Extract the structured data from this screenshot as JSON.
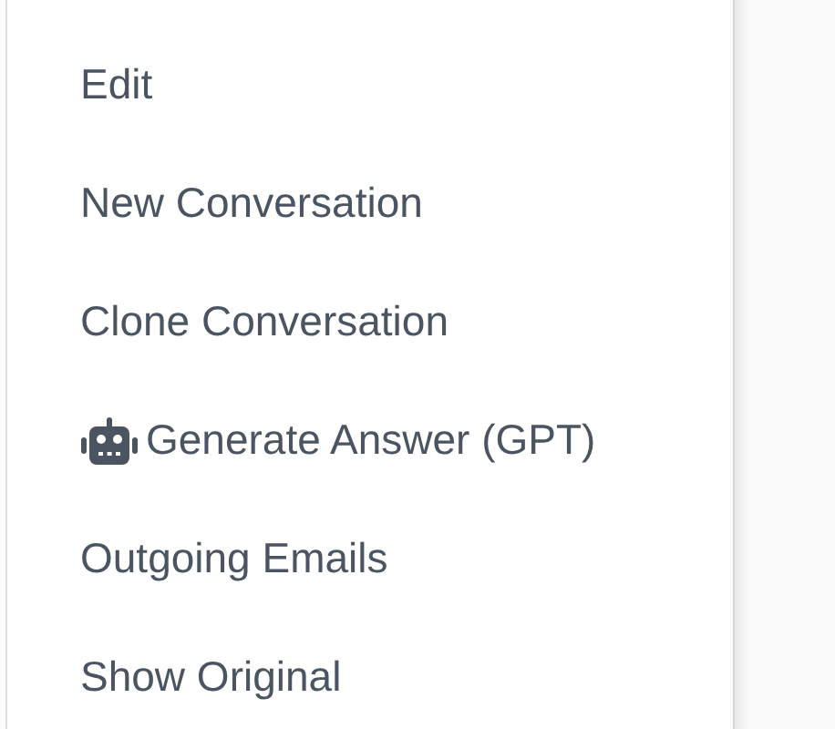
{
  "menu": {
    "items": [
      {
        "kind": "plain",
        "label": "Edit"
      },
      {
        "kind": "plain",
        "label": "New Conversation"
      },
      {
        "kind": "plain",
        "label": "Clone Conversation"
      },
      {
        "kind": "robot",
        "label": "Generate Answer (GPT)"
      },
      {
        "kind": "plain",
        "label": "Outgoing Emails"
      },
      {
        "kind": "plain",
        "label": "Show Original"
      }
    ]
  }
}
